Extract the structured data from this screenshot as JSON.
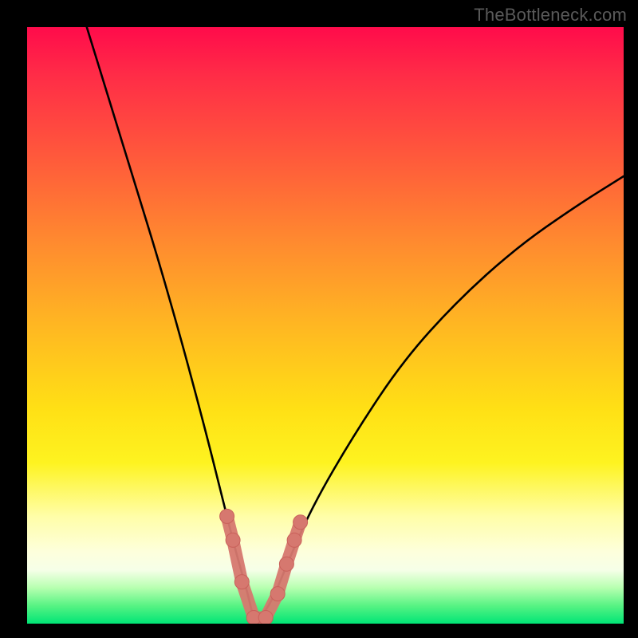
{
  "watermark": "TheBottleneck.com",
  "colors": {
    "frame": "#000000",
    "curve": "#000000",
    "marker_fill": "#d6786f",
    "marker_stroke": "#c9605a",
    "gradient_stops": [
      "#ff0b4b",
      "#ff5a3b",
      "#ffb722",
      "#fef320",
      "#fffea8",
      "#00e576"
    ]
  },
  "chart_data": {
    "type": "line",
    "title": "",
    "xlabel": "",
    "ylabel": "",
    "xlim": [
      0,
      100
    ],
    "ylim": [
      0,
      100
    ],
    "note": "Axes are un-labeled in the image; x/y units are relative positions inferred from pixel geometry (0–100 range). Curve appears to be an absolute-deviation / bottleneck shape with its minimum near x≈38.",
    "series": [
      {
        "name": "bottleneck-curve",
        "x": [
          10,
          14,
          18,
          22,
          26,
          30,
          33,
          35,
          37,
          38,
          40,
          42,
          44,
          48,
          55,
          63,
          72,
          82,
          92,
          100
        ],
        "y": [
          100,
          87,
          74,
          61,
          47,
          32,
          20,
          12,
          5,
          0.5,
          2,
          6,
          11,
          20,
          32,
          44,
          54,
          63,
          70,
          75
        ]
      }
    ],
    "markers": {
      "name": "highlighted-points-near-minimum",
      "x": [
        33.5,
        34.5,
        36,
        38,
        40,
        42,
        43.5,
        44.8,
        45.8
      ],
      "y": [
        18,
        14,
        7,
        1,
        1,
        5,
        10,
        14,
        17
      ]
    }
  }
}
